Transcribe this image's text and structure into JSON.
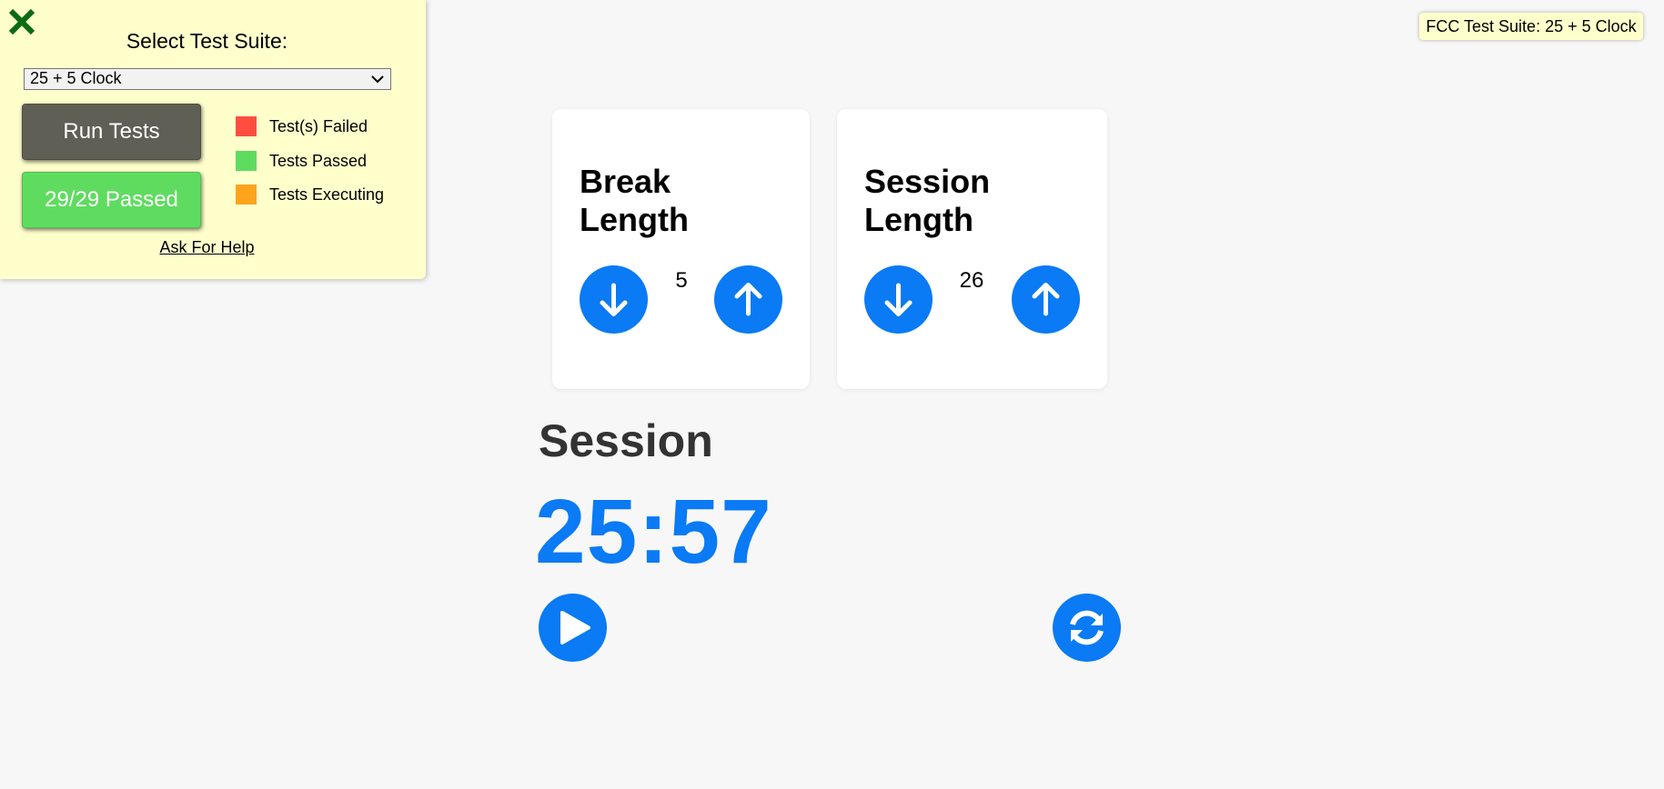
{
  "fcc_panel": {
    "close_icon": "close-x-icon",
    "title": "Select Test Suite:",
    "suite_select": {
      "selected": "25 + 5 Clock"
    },
    "run_button_label": "Run Tests",
    "result_button_label": "29/29 Passed",
    "legend": [
      {
        "label": "Test(s) Failed",
        "color": "#ff4e3f"
      },
      {
        "label": "Tests Passed",
        "color": "#5fdc60"
      },
      {
        "label": "Tests Executing",
        "color": "#ffa41c"
      }
    ],
    "help_link": "Ask For Help"
  },
  "badge": {
    "text": "FCC Test Suite: 25 + 5 Clock"
  },
  "clock": {
    "break": {
      "title": "Break Length",
      "value": "5",
      "decrement_icon": "arrow-down-icon",
      "increment_icon": "arrow-up-icon"
    },
    "session": {
      "title": "Session Length",
      "value": "26",
      "decrement_icon": "arrow-down-icon",
      "increment_icon": "arrow-up-icon"
    },
    "timer_label": "Session",
    "time_left": "25:57",
    "start_stop_icon": "play-icon",
    "reset_icon": "refresh-icon"
  },
  "colors": {
    "accent": "#0a7af5",
    "panel_bg": "#ffffcc",
    "close_icon": "#0a6b12",
    "page_bg": "#f7f7f7"
  }
}
